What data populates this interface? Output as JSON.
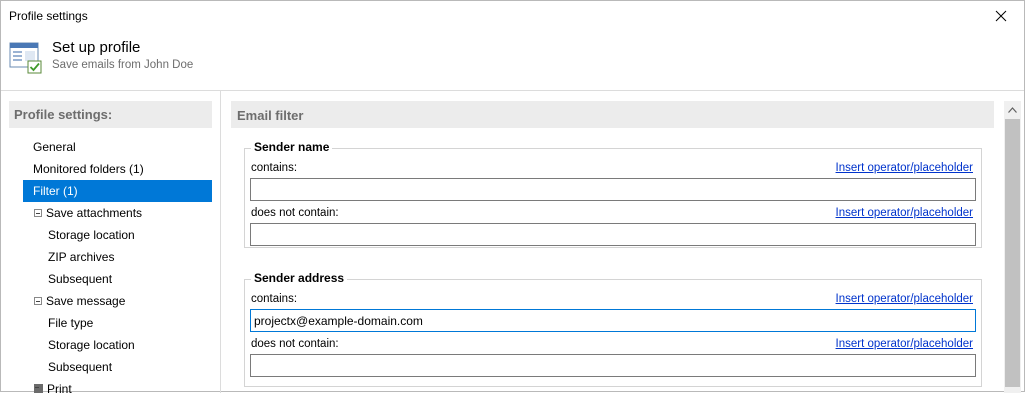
{
  "window": {
    "title": "Profile settings"
  },
  "header": {
    "title": "Set up profile",
    "subtitle": "Save emails from John Doe"
  },
  "sidebar": {
    "heading": "Profile settings:",
    "items": [
      {
        "label": "General",
        "level": "top"
      },
      {
        "label": "Monitored folders (1)",
        "level": "top"
      },
      {
        "label": "Filter (1)",
        "level": "top",
        "selected": true
      },
      {
        "label": "Save attachments",
        "level": "group"
      },
      {
        "label": "Storage location",
        "level": "sub"
      },
      {
        "label": "ZIP archives",
        "level": "sub"
      },
      {
        "label": "Subsequent",
        "level": "sub"
      },
      {
        "label": "Save message",
        "level": "group"
      },
      {
        "label": "File type",
        "level": "sub"
      },
      {
        "label": "Storage location",
        "level": "sub"
      },
      {
        "label": "Subsequent",
        "level": "sub"
      },
      {
        "label": "Print",
        "level": "group"
      }
    ]
  },
  "main": {
    "heading": "Email filter",
    "sender_name": {
      "title": "Sender name",
      "contains_label": "contains:",
      "contains_value": "",
      "not_contains_label": "does not contain:",
      "not_contains_value": "",
      "link_label": "Insert operator/placeholder"
    },
    "sender_address": {
      "title": "Sender address",
      "contains_label": "contains:",
      "contains_value": "projectx@example-domain.com",
      "not_contains_label": "does not contain:",
      "not_contains_value": "",
      "link_label": "Insert operator/placeholder"
    }
  },
  "colors": {
    "selection": "#0078d7",
    "link": "#0033cc",
    "panel_header": "#ececec"
  },
  "icons": {
    "close": "close-icon",
    "header": "profile-settings-icon",
    "scroll_up": "chevron-up-icon"
  }
}
